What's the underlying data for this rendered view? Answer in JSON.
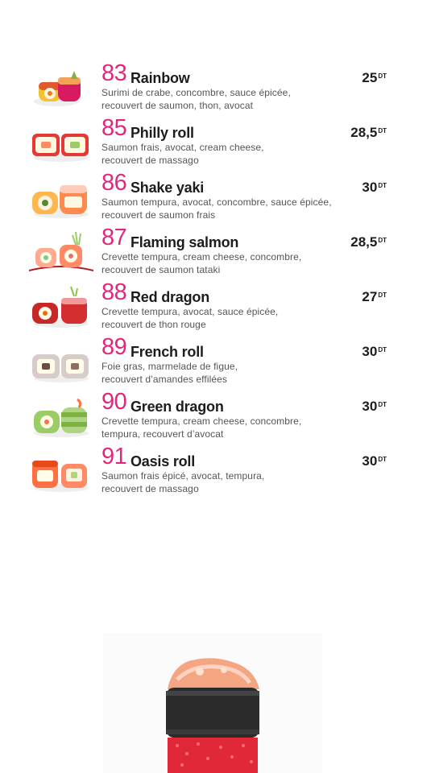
{
  "currency": "DT",
  "items": [
    {
      "number": "83",
      "name": "Rainbow",
      "desc1": "Surimi de crabe, concombre, sauce épicée,",
      "desc2": "recouvert de saumon, thon, avocat",
      "price": "25"
    },
    {
      "number": "85",
      "name": "Philly roll",
      "desc1": "Saumon frais, avocat, cream cheese,",
      "desc2": "recouvert de massago",
      "price": "28,5"
    },
    {
      "number": "86",
      "name": "Shake yaki",
      "desc1": "Saumon tempura, avocat, concombre, sauce épicée,",
      "desc2": "recouvert de saumon frais",
      "price": "30"
    },
    {
      "number": "87",
      "name": "Flaming salmon",
      "desc1": "Crevette tempura, cream cheese, concombre,",
      "desc2": "recouvert de saumon tataki",
      "price": "28,5"
    },
    {
      "number": "88",
      "name": "Red dragon",
      "desc1": "Crevette tempura, avocat, sauce épicée,",
      "desc2": "recouvert de thon rouge",
      "price": "27"
    },
    {
      "number": "89",
      "name": "French roll",
      "desc1": "Foie gras, marmelade de figue,",
      "desc2": "recouvert d’amandes effilées",
      "price": "30"
    },
    {
      "number": "90",
      "name": "Green dragon",
      "desc1": "Crevette tempura, cream cheese, concombre,",
      "desc2": "tempura, recouvert d’avocat",
      "price": "30"
    },
    {
      "number": "91",
      "name": "Oasis roll",
      "desc1": "Saumon frais épicé, avocat, tempura,",
      "desc2": "recouvert de massago",
      "price": "30"
    }
  ]
}
